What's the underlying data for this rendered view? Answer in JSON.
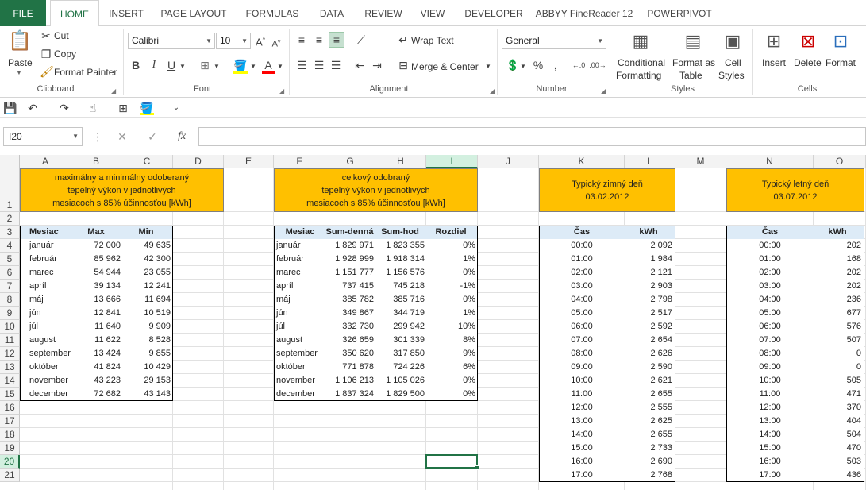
{
  "ribbon_tabs": [
    "FILE",
    "HOME",
    "INSERT",
    "PAGE LAYOUT",
    "FORMULAS",
    "DATA",
    "REVIEW",
    "VIEW",
    "DEVELOPER",
    "ABBYY FineReader 12",
    "POWERPIVOT"
  ],
  "clipboard": {
    "paste": "Paste",
    "cut": "Cut",
    "copy": "Copy",
    "format_painter": "Format Painter",
    "label": "Clipboard"
  },
  "font": {
    "name": "Calibri",
    "size": "10",
    "label": "Font"
  },
  "alignment": {
    "wrap": "Wrap Text",
    "merge": "Merge & Center",
    "label": "Alignment"
  },
  "number": {
    "format": "General",
    "label": "Number"
  },
  "styles": {
    "cond1": "Conditional",
    "cond2": "Formatting",
    "fmt1": "Format as",
    "fmt2": "Table",
    "cell1": "Cell",
    "cell2": "Styles",
    "label": "Styles"
  },
  "cells": {
    "insert": "Insert",
    "delete": "Delete",
    "format": "Format",
    "label": "Cells"
  },
  "namebox": "I20",
  "columns": [
    "A",
    "B",
    "C",
    "D",
    "E",
    "F",
    "G",
    "H",
    "I",
    "J",
    "K",
    "L",
    "M",
    "N",
    "O"
  ],
  "rows": [
    "1",
    "2",
    "3",
    "4",
    "5",
    "6",
    "7",
    "8",
    "9",
    "10",
    "11",
    "12",
    "13",
    "14",
    "15",
    "16",
    "17",
    "18",
    "19",
    "20",
    "21"
  ],
  "title1": [
    "maximálny a minimálny odoberaný",
    "tepelný výkon v jednotlivých",
    "mesiacoch s 85% účinnosťou [kWh]"
  ],
  "title2": [
    "celkový odobraný",
    "tepelný výkon v jednotlivých",
    "mesiacoch s 85% účinnosťou [kWh]"
  ],
  "title3": [
    "Typický zimný deň",
    "03.02.2012"
  ],
  "title4": [
    "Typický letný deň",
    "03.07.2012"
  ],
  "table1": {
    "headers": [
      "Mesiac",
      "Max",
      "Min"
    ],
    "rows": [
      [
        "január",
        "72 000",
        "49 635"
      ],
      [
        "február",
        "85 962",
        "42 300"
      ],
      [
        "marec",
        "54 944",
        "23 055"
      ],
      [
        "apríl",
        "39 134",
        "12 241"
      ],
      [
        "máj",
        "13 666",
        "11 694"
      ],
      [
        "jún",
        "12 841",
        "10 519"
      ],
      [
        "júl",
        "11 640",
        "9 909"
      ],
      [
        "august",
        "11 622",
        "8 528"
      ],
      [
        "september",
        "13 424",
        "9 855"
      ],
      [
        "október",
        "41 824",
        "10 429"
      ],
      [
        "november",
        "43 223",
        "29 153"
      ],
      [
        "december",
        "72 682",
        "43 143"
      ]
    ]
  },
  "table2": {
    "headers": [
      "Mesiac",
      "Sum-denná",
      "Sum-hod",
      "Rozdiel"
    ],
    "rows": [
      [
        "január",
        "1 829 971",
        "1 823 355",
        "0%"
      ],
      [
        "február",
        "1 928 999",
        "1 918 314",
        "1%"
      ],
      [
        "marec",
        "1 151 777",
        "1 156 576",
        "0%"
      ],
      [
        "apríl",
        "737 415",
        "745 218",
        "-1%"
      ],
      [
        "máj",
        "385 782",
        "385 716",
        "0%"
      ],
      [
        "jún",
        "349 867",
        "344 719",
        "1%"
      ],
      [
        "júl",
        "332 730",
        "299 942",
        "10%"
      ],
      [
        "august",
        "326 659",
        "301 339",
        "8%"
      ],
      [
        "september",
        "350 620",
        "317 850",
        "9%"
      ],
      [
        "október",
        "771 878",
        "724 226",
        "6%"
      ],
      [
        "november",
        "1 106 213",
        "1 105 026",
        "0%"
      ],
      [
        "december",
        "1 837 324",
        "1 829 500",
        "0%"
      ]
    ]
  },
  "table3": {
    "headers": [
      "Čas",
      "kWh"
    ],
    "rows": [
      [
        "00:00",
        "2 092"
      ],
      [
        "01:00",
        "1 984"
      ],
      [
        "02:00",
        "2 121"
      ],
      [
        "03:00",
        "2 903"
      ],
      [
        "04:00",
        "2 798"
      ],
      [
        "05:00",
        "2 517"
      ],
      [
        "06:00",
        "2 592"
      ],
      [
        "07:00",
        "2 654"
      ],
      [
        "08:00",
        "2 626"
      ],
      [
        "09:00",
        "2 590"
      ],
      [
        "10:00",
        "2 621"
      ],
      [
        "11:00",
        "2 655"
      ],
      [
        "12:00",
        "2 555"
      ],
      [
        "13:00",
        "2 625"
      ],
      [
        "14:00",
        "2 655"
      ],
      [
        "15:00",
        "2 733"
      ],
      [
        "16:00",
        "2 690"
      ],
      [
        "17:00",
        "2 768"
      ]
    ]
  },
  "table4": {
    "headers": [
      "Čas",
      "kWh"
    ],
    "rows": [
      [
        "00:00",
        "202"
      ],
      [
        "01:00",
        "168"
      ],
      [
        "02:00",
        "202"
      ],
      [
        "03:00",
        "202"
      ],
      [
        "04:00",
        "236"
      ],
      [
        "05:00",
        "677"
      ],
      [
        "06:00",
        "576"
      ],
      [
        "07:00",
        "507"
      ],
      [
        "08:00",
        "0"
      ],
      [
        "09:00",
        "0"
      ],
      [
        "10:00",
        "505"
      ],
      [
        "11:00",
        "471"
      ],
      [
        "12:00",
        "370"
      ],
      [
        "13:00",
        "404"
      ],
      [
        "14:00",
        "504"
      ],
      [
        "15:00",
        "470"
      ],
      [
        "16:00",
        "503"
      ],
      [
        "17:00",
        "436"
      ]
    ]
  }
}
